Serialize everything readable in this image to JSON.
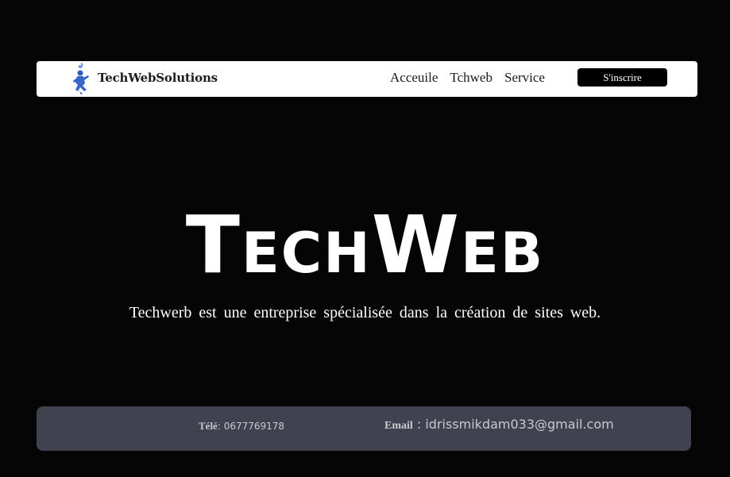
{
  "navbar": {
    "brand": "TechWebSolutions",
    "links": [
      "Acceuile",
      "Tchweb",
      "Service"
    ],
    "signup_label": "S'inscrire",
    "logo_icon": "blue-figure-logo-icon"
  },
  "hero": {
    "title": "TechWeb",
    "subtitle": "Techwerb est une entreprise spécialisée dans la création de sites web."
  },
  "footer": {
    "tel_label": "Télé",
    "tel_sep": ": ",
    "tel_value": "0677769178",
    "email_label": "Email",
    "email_sep": " : ",
    "email_value": "idrissmikdam033@gmail.com"
  },
  "colors": {
    "page_background": "#050506",
    "navbar_background": "#ffffff",
    "logo_blue": "#3a66c8",
    "footer_background": "#40434f",
    "footer_text": "#c9cad0"
  }
}
